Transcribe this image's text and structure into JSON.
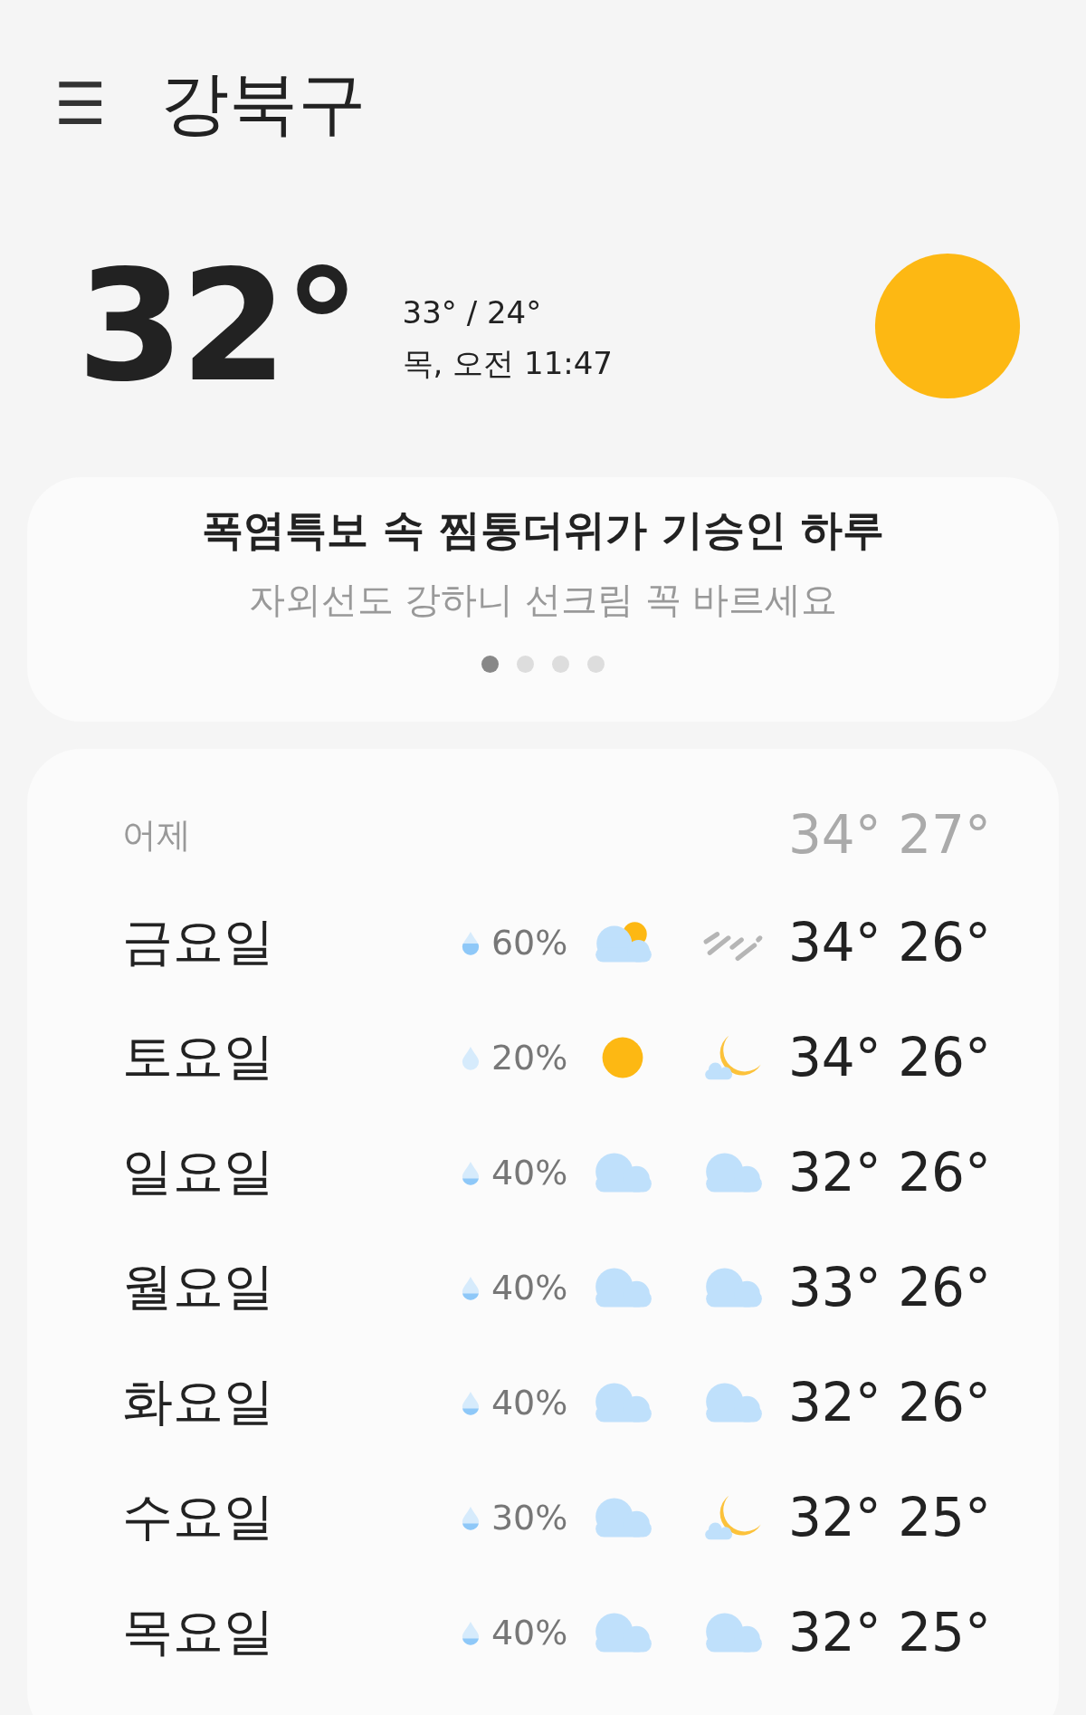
{
  "header": {
    "menu_icon": "☰",
    "location": "강북구"
  },
  "current": {
    "temperature": "32°",
    "high_low": "33° / 24°",
    "datetime": "목, 오전 11:47"
  },
  "banner": {
    "headline": "폭염특보 속 찜통더위가 기승인 하루",
    "subtext": "자외선도 강하니 선크림 꼭 바르세요",
    "pages": [
      {
        "selected": true
      },
      {
        "selected": false
      },
      {
        "selected": false
      },
      {
        "selected": false
      }
    ]
  },
  "yesterday": {
    "label": "어제",
    "temps": "34° 27°"
  },
  "forecast": [
    {
      "day": "금요일",
      "precip": {
        "kind": "half",
        "text": "60%"
      },
      "icons": [
        {
          "kind": "partly-cloudy"
        },
        {
          "kind": "rain"
        }
      ],
      "temps": "34° 26°"
    },
    {
      "day": "토요일",
      "precip": {
        "kind": "empty",
        "text": "20%"
      },
      "icons": [
        {
          "kind": "sun"
        },
        {
          "kind": "moon-cloud"
        }
      ],
      "temps": "34° 26°"
    },
    {
      "day": "일요일",
      "precip": {
        "kind": "low",
        "text": "40%"
      },
      "icons": [
        {
          "kind": "cloud"
        },
        {
          "kind": "cloud"
        }
      ],
      "temps": "32° 26°"
    },
    {
      "day": "월요일",
      "precip": {
        "kind": "low",
        "text": "40%"
      },
      "icons": [
        {
          "kind": "cloud"
        },
        {
          "kind": "cloud"
        }
      ],
      "temps": "33° 26°"
    },
    {
      "day": "화요일",
      "precip": {
        "kind": "low",
        "text": "40%"
      },
      "icons": [
        {
          "kind": "cloud"
        },
        {
          "kind": "cloud"
        }
      ],
      "temps": "32° 26°"
    },
    {
      "day": "수요일",
      "precip": {
        "kind": "low",
        "text": "30%"
      },
      "icons": [
        {
          "kind": "cloud"
        },
        {
          "kind": "moon-cloud"
        }
      ],
      "temps": "32° 25°"
    },
    {
      "day": "목요일",
      "precip": {
        "kind": "low",
        "text": "40%"
      },
      "icons": [
        {
          "kind": "cloud"
        },
        {
          "kind": "cloud"
        }
      ],
      "temps": "32° 25°"
    }
  ]
}
